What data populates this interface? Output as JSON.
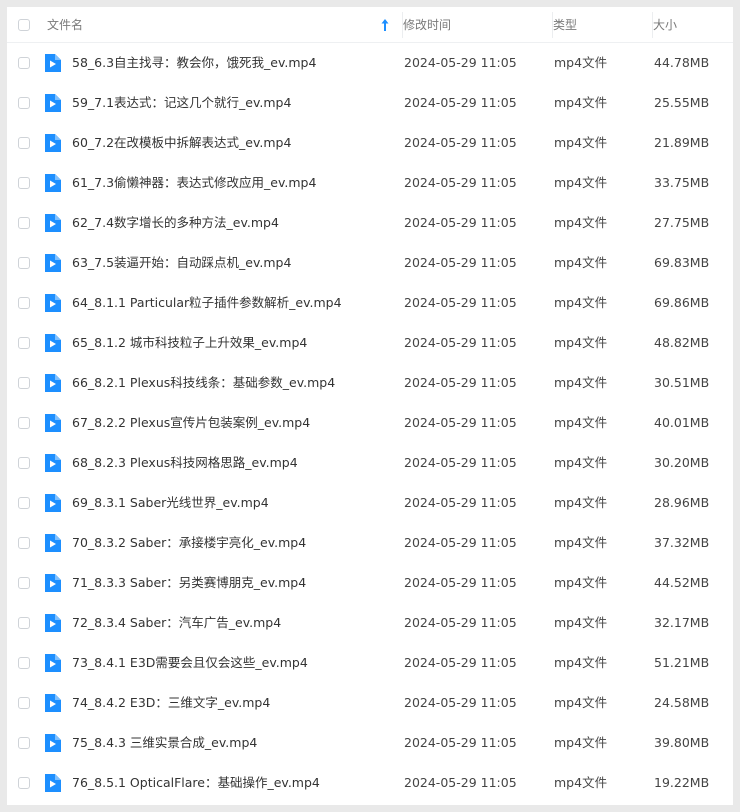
{
  "columns": {
    "name": "文件名",
    "modified": "修改时间",
    "type": "类型",
    "size": "大小"
  },
  "sort": {
    "column": "name",
    "direction": "ascending",
    "icon": "arrow-up-icon"
  },
  "accent_color": "#1d8fff",
  "files": [
    {
      "name": "58_6.3自主找寻：教会你，饿死我_ev.mp4",
      "modified": "2024-05-29 11:05",
      "type": "mp4文件",
      "size": "44.78MB"
    },
    {
      "name": "59_7.1表达式：记这几个就行_ev.mp4",
      "modified": "2024-05-29 11:05",
      "type": "mp4文件",
      "size": "25.55MB"
    },
    {
      "name": "60_7.2在改模板中拆解表达式_ev.mp4",
      "modified": "2024-05-29 11:05",
      "type": "mp4文件",
      "size": "21.89MB"
    },
    {
      "name": "61_7.3偷懒神器：表达式修改应用_ev.mp4",
      "modified": "2024-05-29 11:05",
      "type": "mp4文件",
      "size": "33.75MB"
    },
    {
      "name": "62_7.4数字增长的多种方法_ev.mp4",
      "modified": "2024-05-29 11:05",
      "type": "mp4文件",
      "size": "27.75MB"
    },
    {
      "name": "63_7.5装逼开始：自动踩点机_ev.mp4",
      "modified": "2024-05-29 11:05",
      "type": "mp4文件",
      "size": "69.83MB"
    },
    {
      "name": "64_8.1.1 Particular粒子插件参数解析_ev.mp4",
      "modified": "2024-05-29 11:05",
      "type": "mp4文件",
      "size": "69.86MB"
    },
    {
      "name": "65_8.1.2 城市科技粒子上升效果_ev.mp4",
      "modified": "2024-05-29 11:05",
      "type": "mp4文件",
      "size": "48.82MB"
    },
    {
      "name": "66_8.2.1 Plexus科技线条：基础参数_ev.mp4",
      "modified": "2024-05-29 11:05",
      "type": "mp4文件",
      "size": "30.51MB"
    },
    {
      "name": "67_8.2.2 Plexus宣传片包装案例_ev.mp4",
      "modified": "2024-05-29 11:05",
      "type": "mp4文件",
      "size": "40.01MB"
    },
    {
      "name": "68_8.2.3 Plexus科技网格思路_ev.mp4",
      "modified": "2024-05-29 11:05",
      "type": "mp4文件",
      "size": "30.20MB"
    },
    {
      "name": "69_8.3.1 Saber光线世界_ev.mp4",
      "modified": "2024-05-29 11:05",
      "type": "mp4文件",
      "size": "28.96MB"
    },
    {
      "name": "70_8.3.2 Saber：承接楼宇亮化_ev.mp4",
      "modified": "2024-05-29 11:05",
      "type": "mp4文件",
      "size": "37.32MB"
    },
    {
      "name": "71_8.3.3 Saber：另类赛博朋克_ev.mp4",
      "modified": "2024-05-29 11:05",
      "type": "mp4文件",
      "size": "44.52MB"
    },
    {
      "name": "72_8.3.4 Saber：汽车广告_ev.mp4",
      "modified": "2024-05-29 11:05",
      "type": "mp4文件",
      "size": "32.17MB"
    },
    {
      "name": "73_8.4.1 E3D需要会且仅会这些_ev.mp4",
      "modified": "2024-05-29 11:05",
      "type": "mp4文件",
      "size": "51.21MB"
    },
    {
      "name": "74_8.4.2 E3D：三维文字_ev.mp4",
      "modified": "2024-05-29 11:05",
      "type": "mp4文件",
      "size": "24.58MB"
    },
    {
      "name": "75_8.4.3 三维实景合成_ev.mp4",
      "modified": "2024-05-29 11:05",
      "type": "mp4文件",
      "size": "39.80MB"
    },
    {
      "name": "76_8.5.1 OpticalFlare：基础操作_ev.mp4",
      "modified": "2024-05-29 11:05",
      "type": "mp4文件",
      "size": "19.22MB"
    }
  ]
}
